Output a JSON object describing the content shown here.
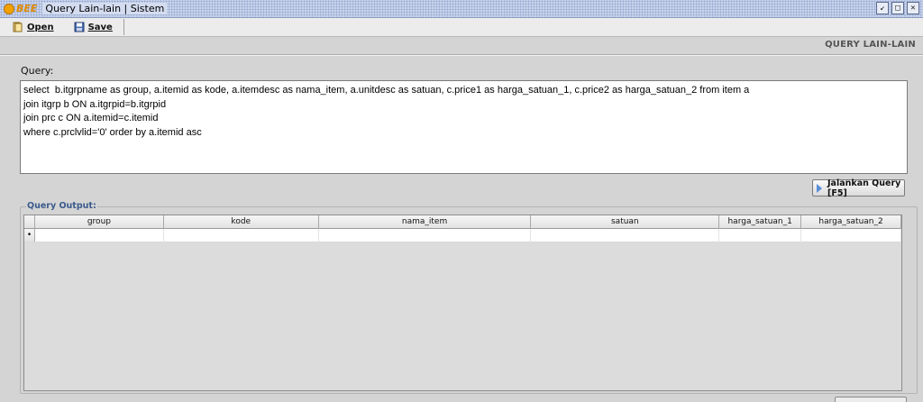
{
  "window": {
    "logo_text": "BEE",
    "title": "Query Lain-lain | Sistem",
    "buttons": [
      "restore-icon",
      "maximize-icon",
      "close-icon"
    ]
  },
  "toolbar": {
    "open_label": "Open",
    "save_label": "Save",
    "open_icon": "open-folder-icon",
    "save_icon": "floppy-disk-icon"
  },
  "page": {
    "section_title": "QUERY LAIN-LAIN",
    "query_label": "Query:",
    "query_text": "select  b.itgrpname as group, a.itemid as kode, a.itemdesc as nama_item, a.unitdesc as satuan, c.price1 as harga_satuan_1, c.price2 as harga_satuan_2 from item a\njoin itgrp b ON a.itgrpid=b.itgrpid\njoin prc c ON a.itemid=c.itemid\nwhere c.prclvlid='0' order by a.itemid asc",
    "run_button_label": "Jalankan Query [F5]",
    "output_label": "Query Output:"
  },
  "grid": {
    "columns": [
      "group",
      "kode",
      "nama_item",
      "satuan",
      "harga_satuan_1",
      "harga_satuan_2"
    ],
    "row_indicator": "•"
  }
}
